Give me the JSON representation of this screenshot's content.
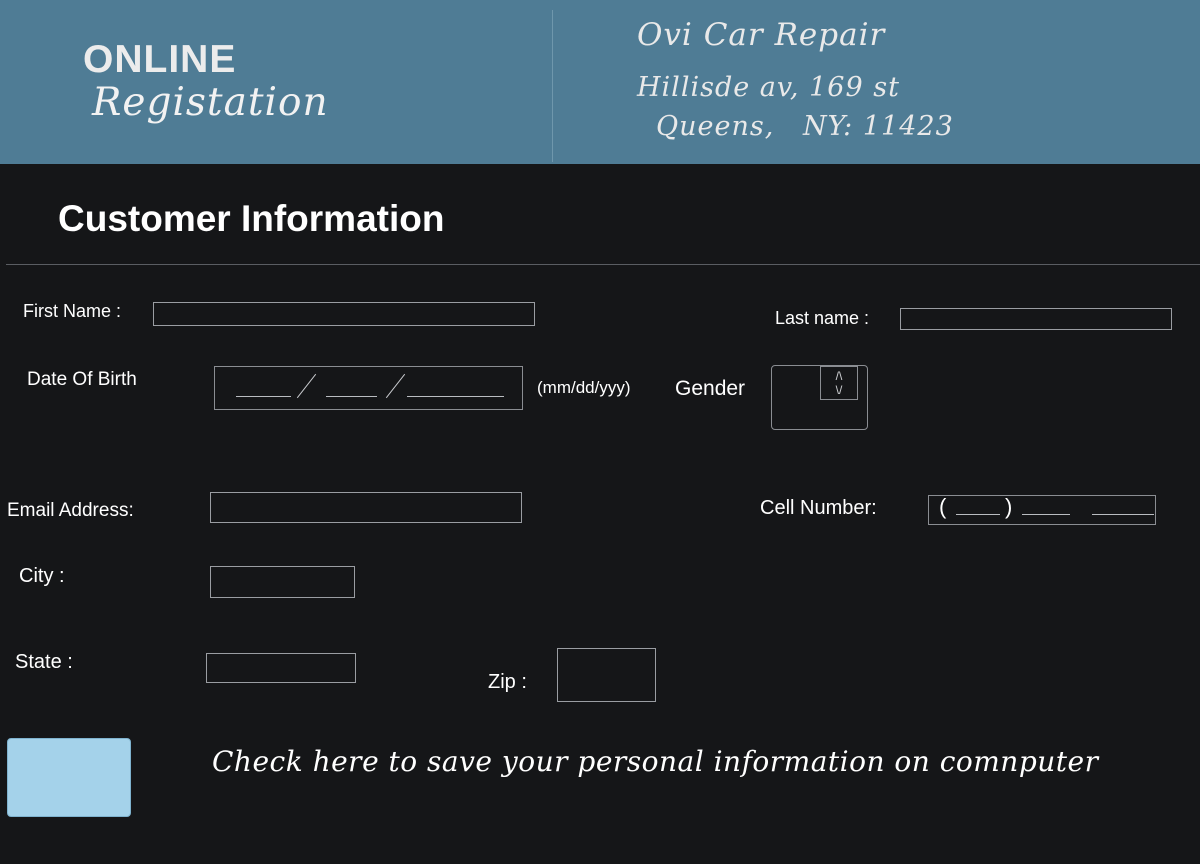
{
  "header": {
    "title_line1": "ONLINE",
    "title_line2": "Registation",
    "business_name": "Ovi Car Repair",
    "address_line1": "Hillisde av, 169 st",
    "address_line2": "Queens,   NY: 11423",
    "background_color": "#4f7c95"
  },
  "section_title": "Customer Information",
  "form": {
    "first_name": {
      "label": "First Name :",
      "value": ""
    },
    "last_name": {
      "label": "Last name :",
      "value": ""
    },
    "date_of_birth": {
      "label": "Date Of Birth",
      "format_hint": "(mm/dd/yyy)",
      "slash": "/"
    },
    "gender": {
      "label": "Gender",
      "value": ""
    },
    "email": {
      "label": "Email Address:",
      "value": ""
    },
    "cell": {
      "label": "Cell Number:",
      "open_paren": "(",
      "close_paren": ")"
    },
    "city": {
      "label": "City :",
      "value": ""
    },
    "state": {
      "label": "State :",
      "value": ""
    },
    "zip": {
      "label": "Zip :",
      "value": ""
    }
  },
  "save_info": {
    "text": "Check here to save your personal information on comnputer",
    "checked": false,
    "checkbox_color": "#a4d2ea"
  },
  "icons": {
    "gender_spinner": "up-down-arrows-icon"
  }
}
